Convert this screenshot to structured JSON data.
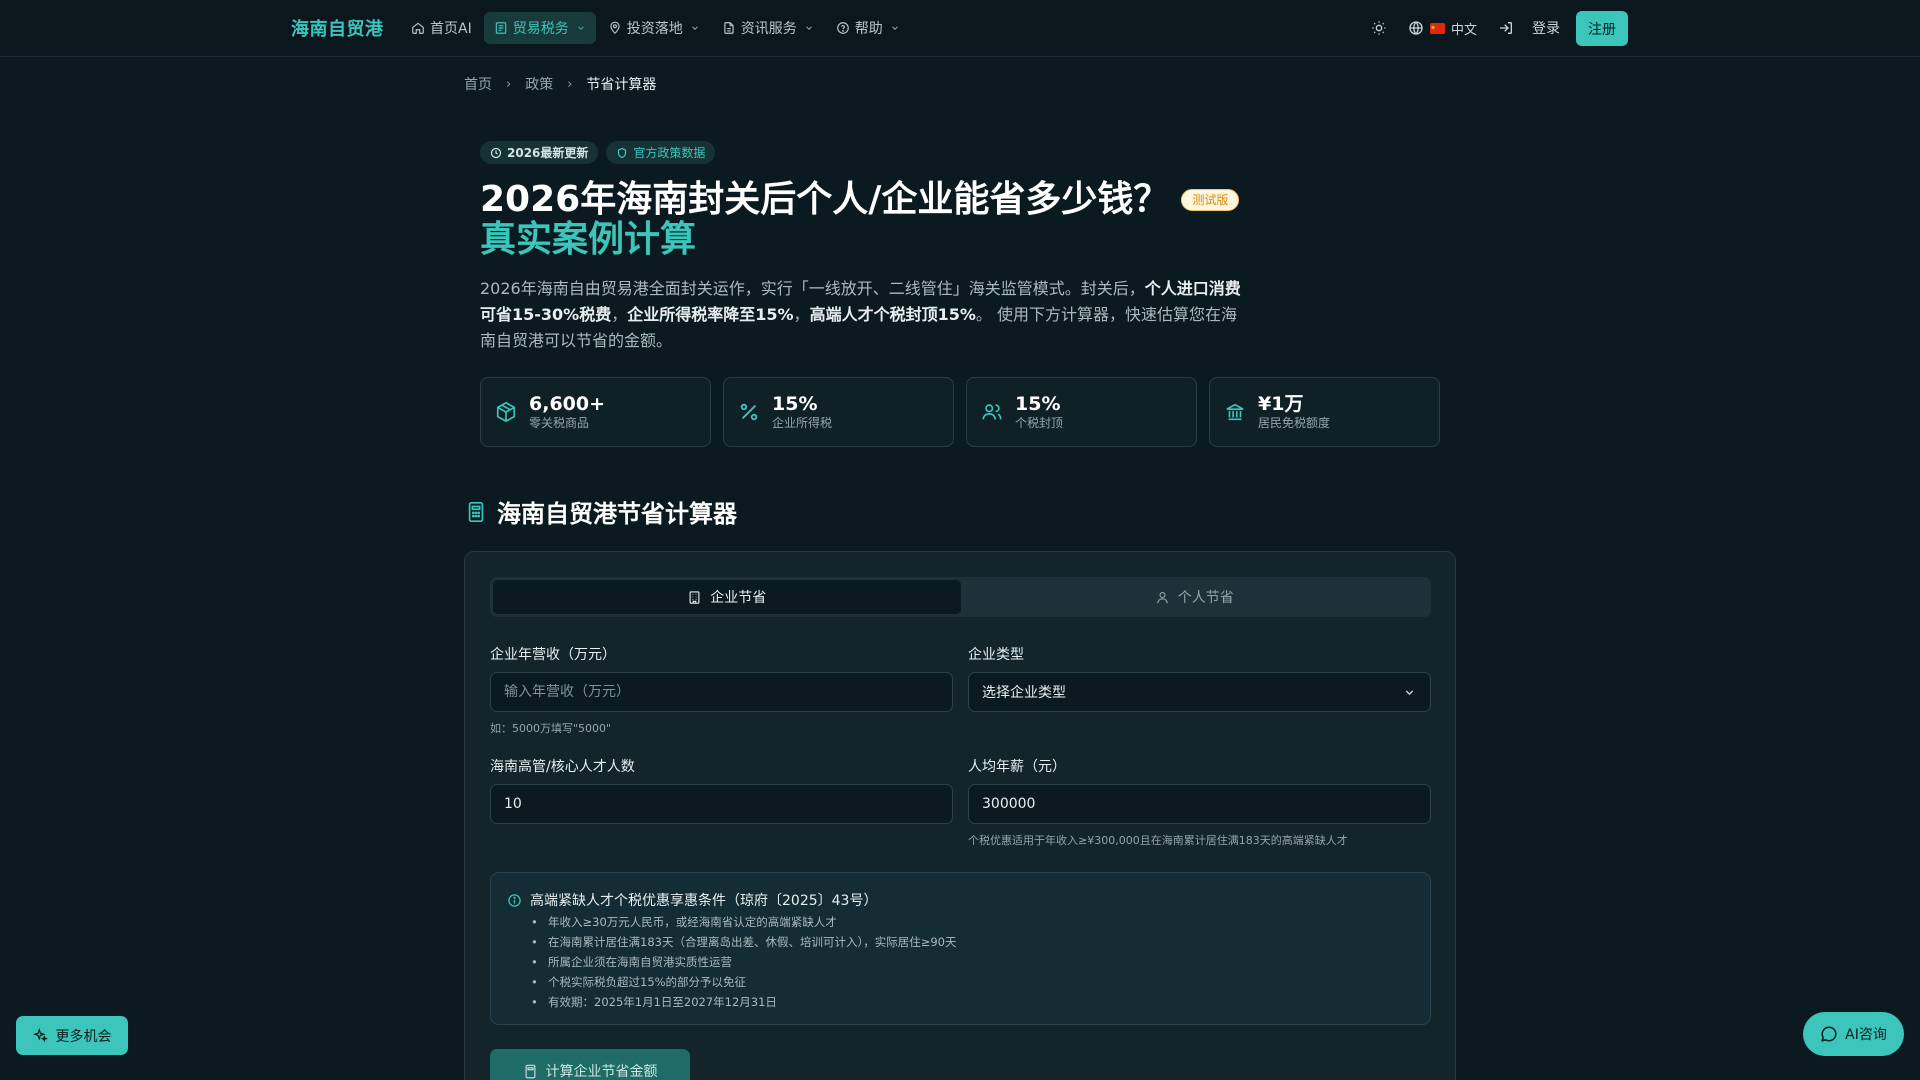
{
  "brand": "海南自贸港",
  "nav": {
    "items": [
      {
        "label": "首页AI",
        "icon": "home-icon",
        "dropdown": false
      },
      {
        "label": "贸易税务",
        "icon": "document-icon",
        "dropdown": true,
        "active": true
      },
      {
        "label": "投资落地",
        "icon": "map-pin-icon",
        "dropdown": true
      },
      {
        "label": "资讯服务",
        "icon": "file-text-icon",
        "dropdown": true
      },
      {
        "label": "帮助",
        "icon": "help-circle-icon",
        "dropdown": true
      }
    ],
    "language": "中文",
    "login": "登录",
    "register": "注册"
  },
  "breadcrumb": [
    "首页",
    "政策",
    "节省计算器"
  ],
  "badges": {
    "update": "2026最新更新",
    "official": "官方政策数据"
  },
  "hero": {
    "title": "2026年海南封关后个人/企业能省多少钱？",
    "beta": "测试版",
    "subtitle": "真实案例计算",
    "desc_1": "2026年海南自由贸易港全面封关运作，实行「一线放开、二线管住」海关监管模式。封关后，",
    "desc_b1": "个人进口消费可省15-30%税费",
    "desc_2": "，",
    "desc_b2": "企业所得税率降至15%",
    "desc_3": "，",
    "desc_b3": "高端人才个税封顶15%",
    "desc_4": "。 使用下方计算器，快速估算您在海南自贸港可以节省的金额。"
  },
  "stats": [
    {
      "value": "6,600+",
      "label": "零关税商品",
      "icon": "package-icon"
    },
    {
      "value": "15%",
      "label": "企业所得税",
      "icon": "percent-icon"
    },
    {
      "value": "15%",
      "label": "个税封顶",
      "icon": "users-icon"
    },
    {
      "value": "¥1万",
      "label": "居民免税额度",
      "icon": "bank-icon"
    }
  ],
  "calculator": {
    "heading": "海南自贸港节省计算器",
    "tabs": [
      "企业节省",
      "个人节省"
    ],
    "revenue_label": "企业年营收（万元）",
    "revenue_placeholder": "输入年营收（万元）",
    "revenue_hint": "如：5000万填写\"5000\"",
    "type_label": "企业类型",
    "type_value": "选择企业类型",
    "talent_label": "海南高管/核心人才人数",
    "talent_value": "10",
    "salary_label": "人均年薪（元）",
    "salary_value": "300000",
    "salary_hint": "个税优惠适用于年收入≥¥300,000且在海南累计居住满183天的高端紧缺人才",
    "info_title": "高端紧缺人才个税优惠享惠条件（琼府〔2025〕43号）",
    "info_items": [
      "年收入≥30万元人民币，或经海南省认定的高端紧缺人才",
      "在海南累计居住满183天（合理离岛出差、休假、培训可计入），实际居住≥90天",
      "所属企业须在海南自贸港实质性运营",
      "个税实际税负超过15%的部分予以免征",
      "有效期：2025年1月1日至2027年12月31日"
    ],
    "calc_button": "计算企业节省金额"
  },
  "floating": {
    "more": "更多机会",
    "ai": "AI咨询"
  },
  "colors": {
    "accent": "#3cc5bb",
    "background": "#0b1a20",
    "beta_text": "#d98c10"
  }
}
